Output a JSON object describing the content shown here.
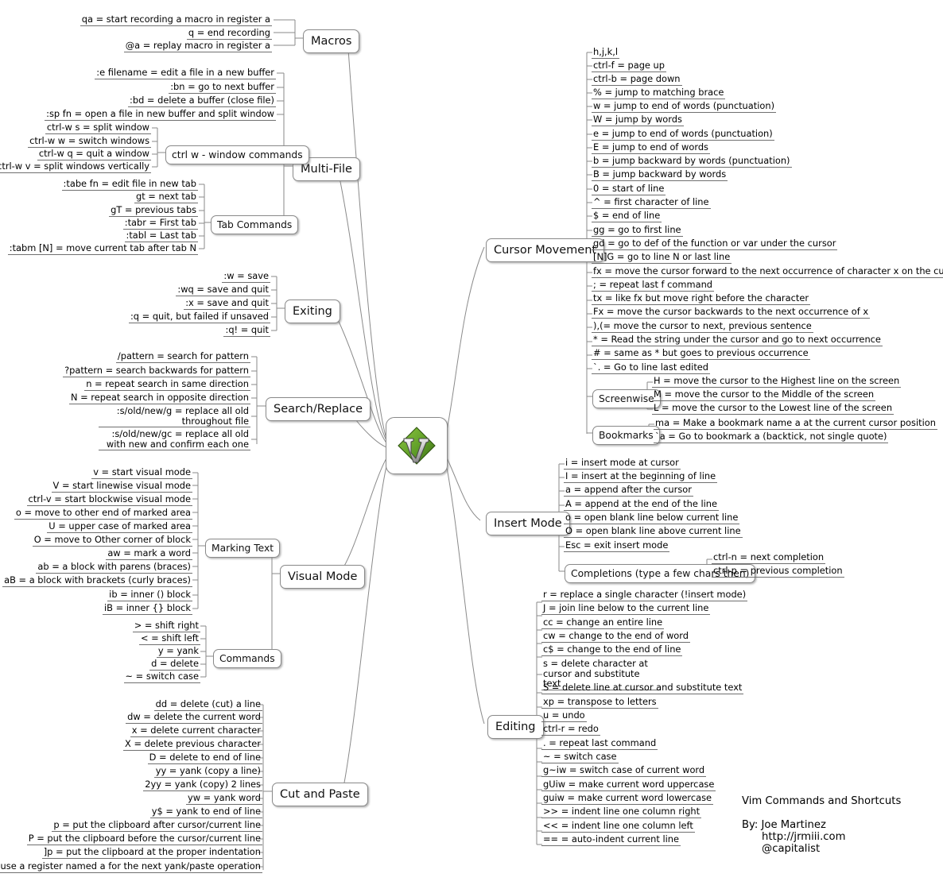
{
  "title": "Vim Commands and Shortcuts",
  "central": {
    "icon": "vim-logo-icon",
    "label": "Vim"
  },
  "credits": {
    "heading": "Vim Commands and Shortcuts",
    "author": "By: Joe Martinez",
    "website": "http://jrmiii.com",
    "twitter": "@capitalist"
  },
  "branches": {
    "macros": {
      "label": "Macros",
      "items": [
        "qa = start recording a macro in register a",
        "q = end recording",
        "@a = replay macro in register a"
      ]
    },
    "multifile": {
      "label": "Multi-File",
      "items": [
        ":e filename = edit a file in a new buffer",
        ":bn = go to next buffer",
        ":bd = delete a buffer (close file)",
        ":sp fn = open a file in new buffer and split window"
      ],
      "window_commands": {
        "label": "ctrl w - window commands",
        "items": [
          "ctrl-w s = split window",
          "ctrl-w w = switch windows",
          "ctrl-w q = quit a window",
          "ctrl-w v = split windows vertically"
        ]
      },
      "tab_commands": {
        "label": "Tab Commands",
        "items": [
          ":tabe fn = edit file in new tab",
          "gt = next tab",
          "gT = previous tabs",
          ":tabr = First tab",
          ":tabl = Last tab",
          ":tabm [N] = move current tab after tab N"
        ]
      }
    },
    "exiting": {
      "label": "Exiting",
      "items": [
        ":w = save",
        ":wq = save and quit",
        ":x = save and quit",
        ":q = quit, but failed if unsaved",
        ":q! = quit"
      ]
    },
    "search_replace": {
      "label": "Search/Replace",
      "items": [
        "/pattern = search for pattern",
        "?pattern = search backwards for pattern",
        "n = repeat search in same direction",
        "N = repeat search in opposite direction",
        ":s/old/new/g = replace all old throughout file",
        ":s/old/new/gc = replace all old with new and confirm each one"
      ]
    },
    "visual_mode": {
      "label": "Visual Mode",
      "marking_text": {
        "label": "Marking Text",
        "items": [
          "v = start visual mode",
          "V = start linewise visual mode",
          "ctrl-v = start blockwise visual mode",
          "o = move to other end of marked area",
          "U = upper case of marked area",
          "O = move to Other corner of block",
          "aw = mark a word",
          "ab = a block with parens (braces)",
          "aB = a block with brackets (curly braces)",
          "ib = inner () block",
          "iB  = inner {} block"
        ]
      },
      "commands": {
        "label": "Commands",
        "items": [
          "> = shift right",
          "< = shift left",
          "y = yank",
          "d = delete",
          "~ = switch case"
        ]
      }
    },
    "cut_and_paste": {
      "label": "Cut and Paste",
      "items": [
        "dd = delete (cut) a line",
        "dw = delete the current word",
        "x = delete current character",
        "X = delete previous character",
        "D = delete to end of line",
        "yy = yank (copy a line)",
        "2yy = yank (copy) 2 lines",
        "yw = yank word",
        "y$ = yank to end of line",
        "p = put the clipboard after cursor/current line",
        "P = put the clipboard before the cursor/current line",
        "]p = put the clipboard at the proper indentation",
        "\"a = use a register named a for the next yank/paste operation"
      ]
    },
    "cursor_movement": {
      "label": "Cursor Movement",
      "items": [
        "h,j,k,l",
        "ctrl-f = page up",
        "ctrl-b = page down",
        "% = jump to matching brace",
        "w = jump to end of words (punctuation)",
        "W = jump by words",
        "e = jump to end of words (punctuation)",
        "E = jump to end of words",
        "b = jump backward by words (punctuation)",
        "B = jump backward by words",
        "0 = start of line",
        "^ = first character of line",
        "$ = end of line",
        "gg = go to first line",
        "gd = go to def of the function or var under the cursor",
        "[N]G = go to line N or last line",
        "fx = move the cursor forward to the next occurrence of character x on the current line",
        "; = repeat last f command",
        "tx = like fx but move right before the character",
        "Fx = move the cursor backwards to the next occurrence of x",
        "),(= move the cursor to next, previous sentence",
        "* = Read the string under the cursor and go to next occurrence",
        "# = same as * but goes to previous occurrence",
        "`. = Go to line last edited"
      ],
      "screenwise": {
        "label": "Screenwise",
        "items": [
          "H = move the cursor to the Highest line on the screen",
          "M = move the cursor to the Middle of the screen",
          "L = move the cursor to the Lowest line of the screen"
        ]
      },
      "bookmarks": {
        "label": "Bookmarks",
        "items": [
          "ma = Make a bookmark name a at the current cursor position",
          "`a = Go to bookmark a (backtick, not single quote)"
        ]
      }
    },
    "insert_mode": {
      "label": "Insert Mode",
      "items": [
        "i = insert mode at cursor",
        "I = insert at the beginning of line",
        "a = append after the cursor",
        "A = append at the end of the line",
        "o = open blank line below current line",
        "O = open blank line above current line",
        "Esc = exit insert mode"
      ],
      "completions": {
        "label": "Completions (type a few chars then)",
        "items": [
          "ctrl-n = next completion",
          "ctrl-p = previous completion"
        ]
      }
    },
    "editing": {
      "label": "Editing",
      "items": [
        "r = replace a single character (!insert mode)",
        "J = join line below to the current line",
        "cc = change an entire line",
        "cw = change to the end of word",
        "c$ = change to the end of line",
        "s = delete character at cursor and substitute text",
        "S = delete line at cursor and substitute text",
        "xp = transpose to letters",
        "u = undo",
        "ctrl-r = redo",
        ". = repeat last command",
        "~ = switch case",
        "g~iw = switch case of current word",
        "gUiw = make current word uppercase",
        "guiw = make current word lowercase",
        ">> = indent line one column right",
        "<< = indent line one column left",
        "== = auto-indent current line"
      ]
    }
  },
  "colors": {
    "line": "#8a8a8a",
    "text": "#000000",
    "background": "#ffffff",
    "logo_green_light": "#7cb342",
    "logo_green_dark": "#4a7a22",
    "logo_gray": "#c8c8c8"
  }
}
